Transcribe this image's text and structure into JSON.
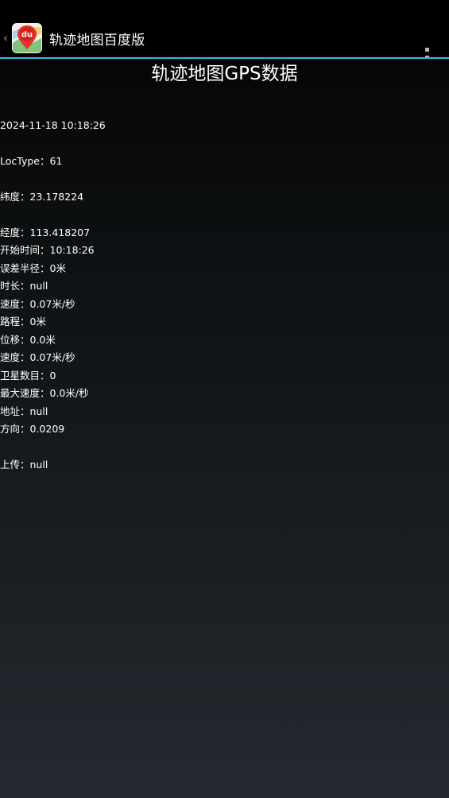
{
  "actionbar": {
    "back_glyph": "‹",
    "app_icon": "baidu-map-app-icon",
    "app_icon_text": "du",
    "title": "轨迹地图百度版",
    "menu_icon": "overflow-menu-icon"
  },
  "page": {
    "title": "轨迹地图GPS数据"
  },
  "location_info": [
    "2024-11-18 10:18:26",
    "LocType：61",
    "纬度：23.178224",
    "经度：113.418207",
    "误差半径：0米",
    "速度：0.07米/秒",
    "位移：0.0米",
    "卫星数目：0",
    "地址：null"
  ],
  "track_info": [
    "开始时间：10:18:26",
    "时长：null",
    "路程：0米",
    "速度：0.07米/秒",
    "最大速度：0.0米/秒",
    "方向：0.0209",
    "上传：null"
  ],
  "colors": {
    "accent_divider": "#33b5e5",
    "app_icon_red": "#e8322d"
  }
}
